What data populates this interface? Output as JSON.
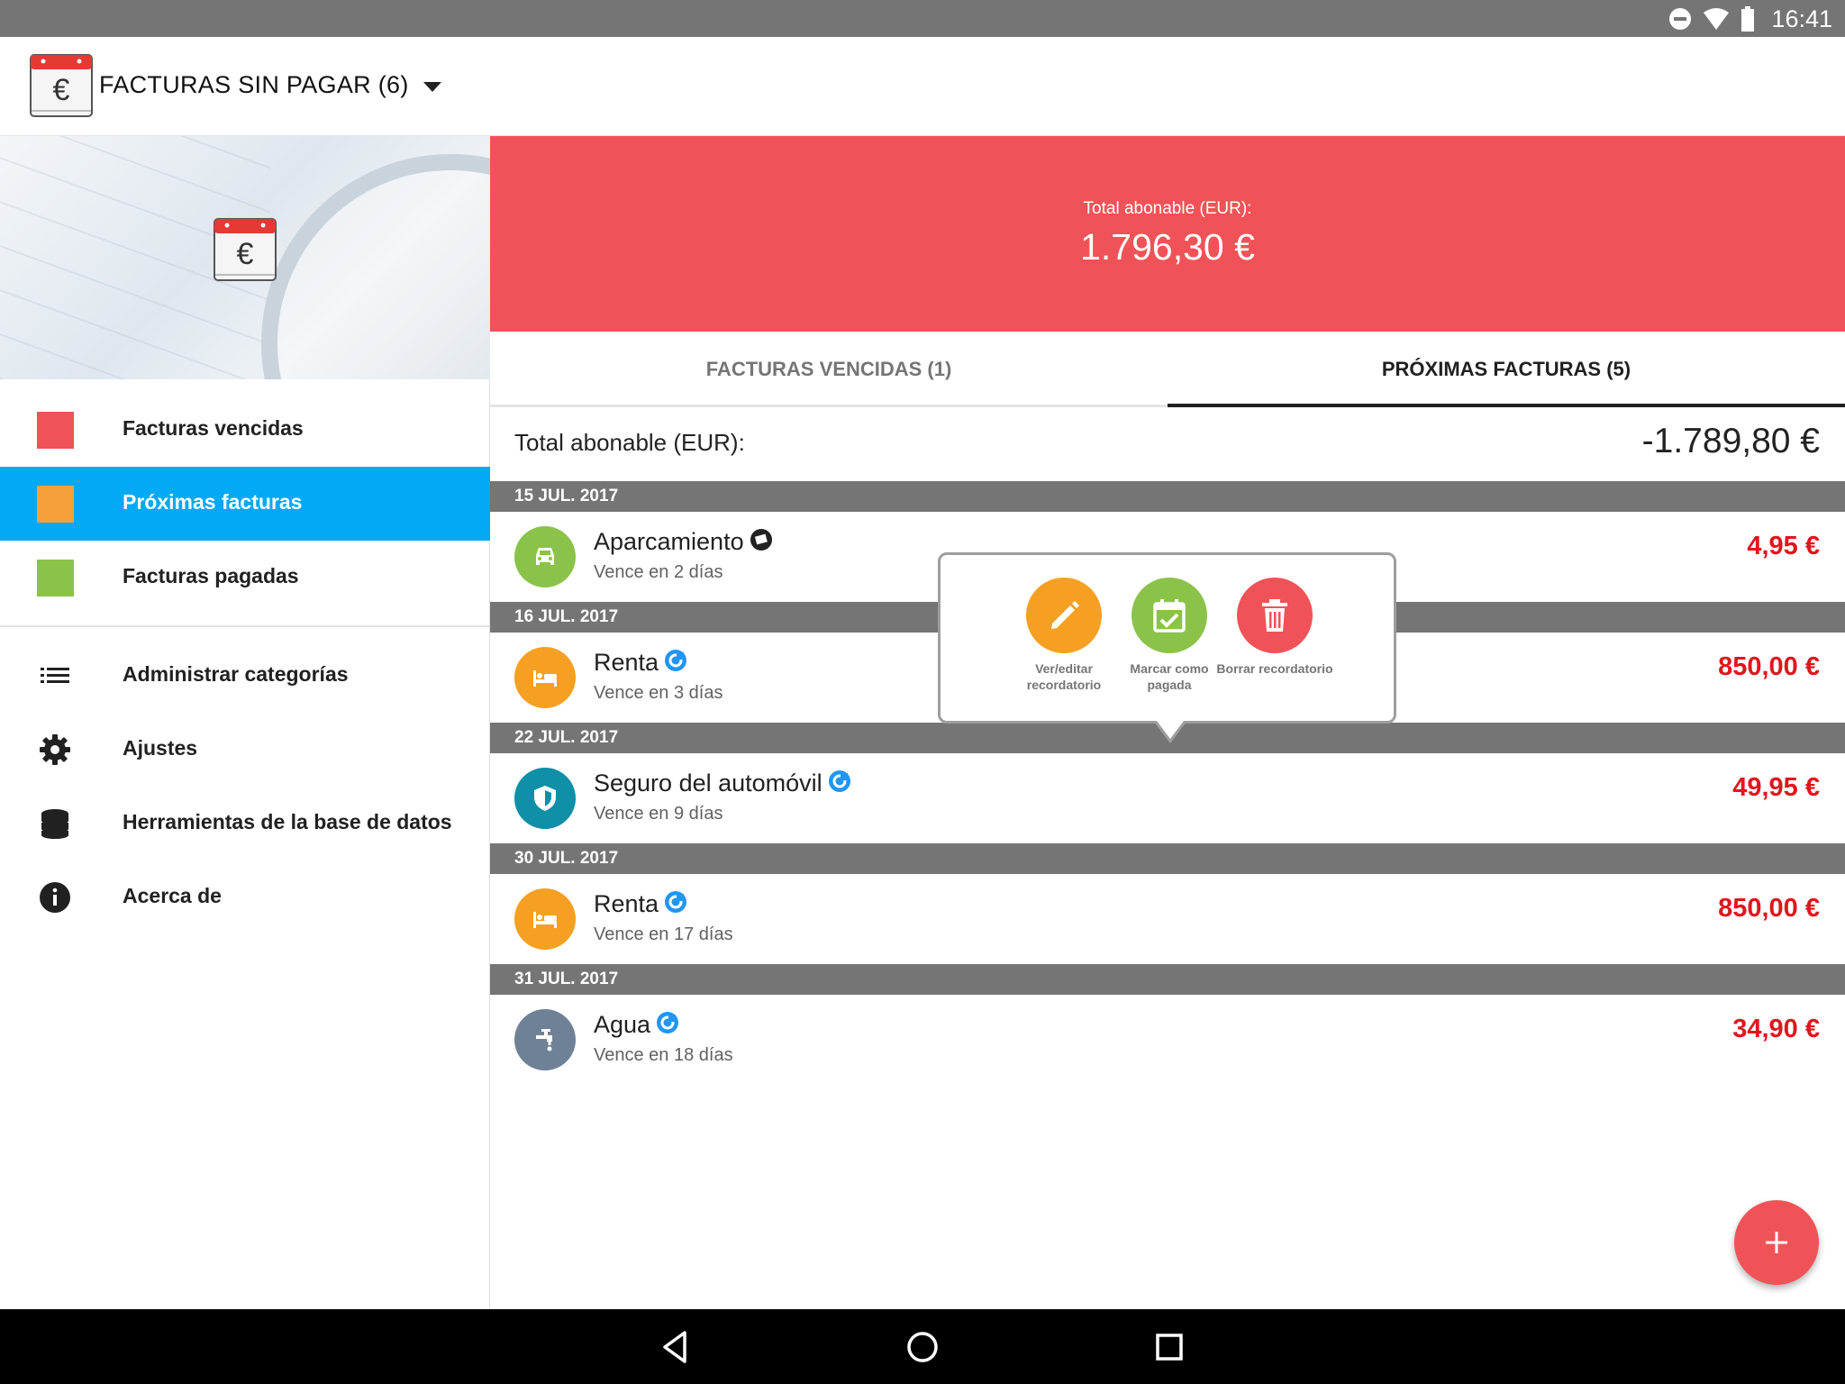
{
  "status_bar": {
    "time": "16:41"
  },
  "app_bar": {
    "title": "FACTURAS SIN PAGAR (6)"
  },
  "drawer": {
    "items": [
      {
        "label": "Facturas vencidas",
        "color": "#f05357"
      },
      {
        "label": "Próximas facturas",
        "color": "#f5a03c"
      },
      {
        "label": "Facturas pagadas",
        "color": "#8bc34a"
      }
    ],
    "tools": [
      {
        "label": "Administrar categorías",
        "icon": "list-icon"
      },
      {
        "label": "Ajustes",
        "icon": "gear-icon"
      },
      {
        "label": "Herramientas de la base de datos",
        "icon": "database-icon"
      },
      {
        "label": "Acerca de",
        "icon": "info-icon"
      }
    ]
  },
  "hero": {
    "label": "Total abonable (EUR):",
    "amount": "1.796,30 €",
    "color": "#f05357"
  },
  "tabs": [
    {
      "label": "FACTURAS VENCIDAS (1)"
    },
    {
      "label": "PRÓXIMAS FACTURAS (5)"
    }
  ],
  "total": {
    "label": "Total abonable (EUR):",
    "value": "-1.789,80 €"
  },
  "groups": [
    {
      "date": "15 JUL. 2017",
      "bill": {
        "name": "Aparcamiento",
        "due": "Vence en 2 días",
        "amount": "4,95 €",
        "icon": "car-icon",
        "color": "#8bc34a"
      }
    },
    {
      "date": "16 JUL. 2017",
      "bill": {
        "name": "Renta",
        "due": "Vence en 3 días",
        "amount": "850,00 €",
        "icon": "bed-icon",
        "color": "#f5a023"
      }
    },
    {
      "date": "22 JUL. 2017",
      "bill": {
        "name": "Seguro del automóvil",
        "due": "Vence en 9 días",
        "amount": "49,95 €",
        "icon": "shield-icon",
        "color": "#0f8fa8"
      }
    },
    {
      "date": "30 JUL. 2017",
      "bill": {
        "name": "Renta",
        "due": "Vence en 17 días",
        "amount": "850,00 €",
        "icon": "bed-icon",
        "color": "#f5a023"
      }
    },
    {
      "date": "31 JUL. 2017",
      "bill": {
        "name": "Agua",
        "due": "Vence en 18 días",
        "amount": "34,90 €",
        "icon": "faucet-icon",
        "color": "#6f8196"
      }
    }
  ],
  "popup": {
    "actions": [
      {
        "label": "Ver/editar recordatorio",
        "icon": "pencil-icon",
        "color": "#f5a023"
      },
      {
        "label": "Marcar como pagada",
        "icon": "calendar-check-icon",
        "color": "#8bc34a"
      },
      {
        "label": "Borrar recordatorio",
        "icon": "trash-icon",
        "color": "#f05357"
      }
    ]
  },
  "fab": {
    "icon": "plus-icon"
  }
}
